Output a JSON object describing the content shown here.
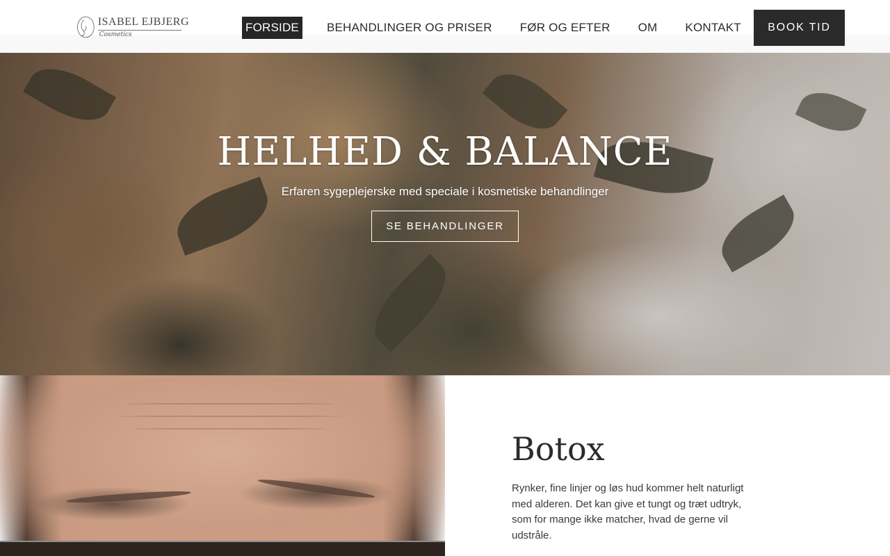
{
  "header": {
    "logo": {
      "name": "ISABEL EJBJERG",
      "sub": "Cosmetics"
    },
    "nav": [
      {
        "label": "FORSIDE",
        "active": true
      },
      {
        "label": "BEHANDLINGER OG PRISER",
        "active": false
      },
      {
        "label": "FØR OG EFTER",
        "active": false
      },
      {
        "label": "OM",
        "active": false
      },
      {
        "label": "KONTAKT",
        "active": false
      }
    ],
    "book_label": "BOOK TID"
  },
  "hero": {
    "title": "HELHED & BALANCE",
    "subtitle": "Erfaren sygeplejerske med speciale i kosmetiske behandlinger",
    "button_label": "SE BEHANDLINGER"
  },
  "section": {
    "title": "Botox",
    "paragraph": "Rynker, fine linjer og løs hud kommer helt naturligt med alderen. Det kan give et tungt og træt udtryk, som for mange ikke matcher, hvad de gerne vil udstråle.",
    "paragraph2": ""
  },
  "colors": {
    "dark": "#262626",
    "text": "#2b2b2b",
    "white": "#ffffff"
  }
}
